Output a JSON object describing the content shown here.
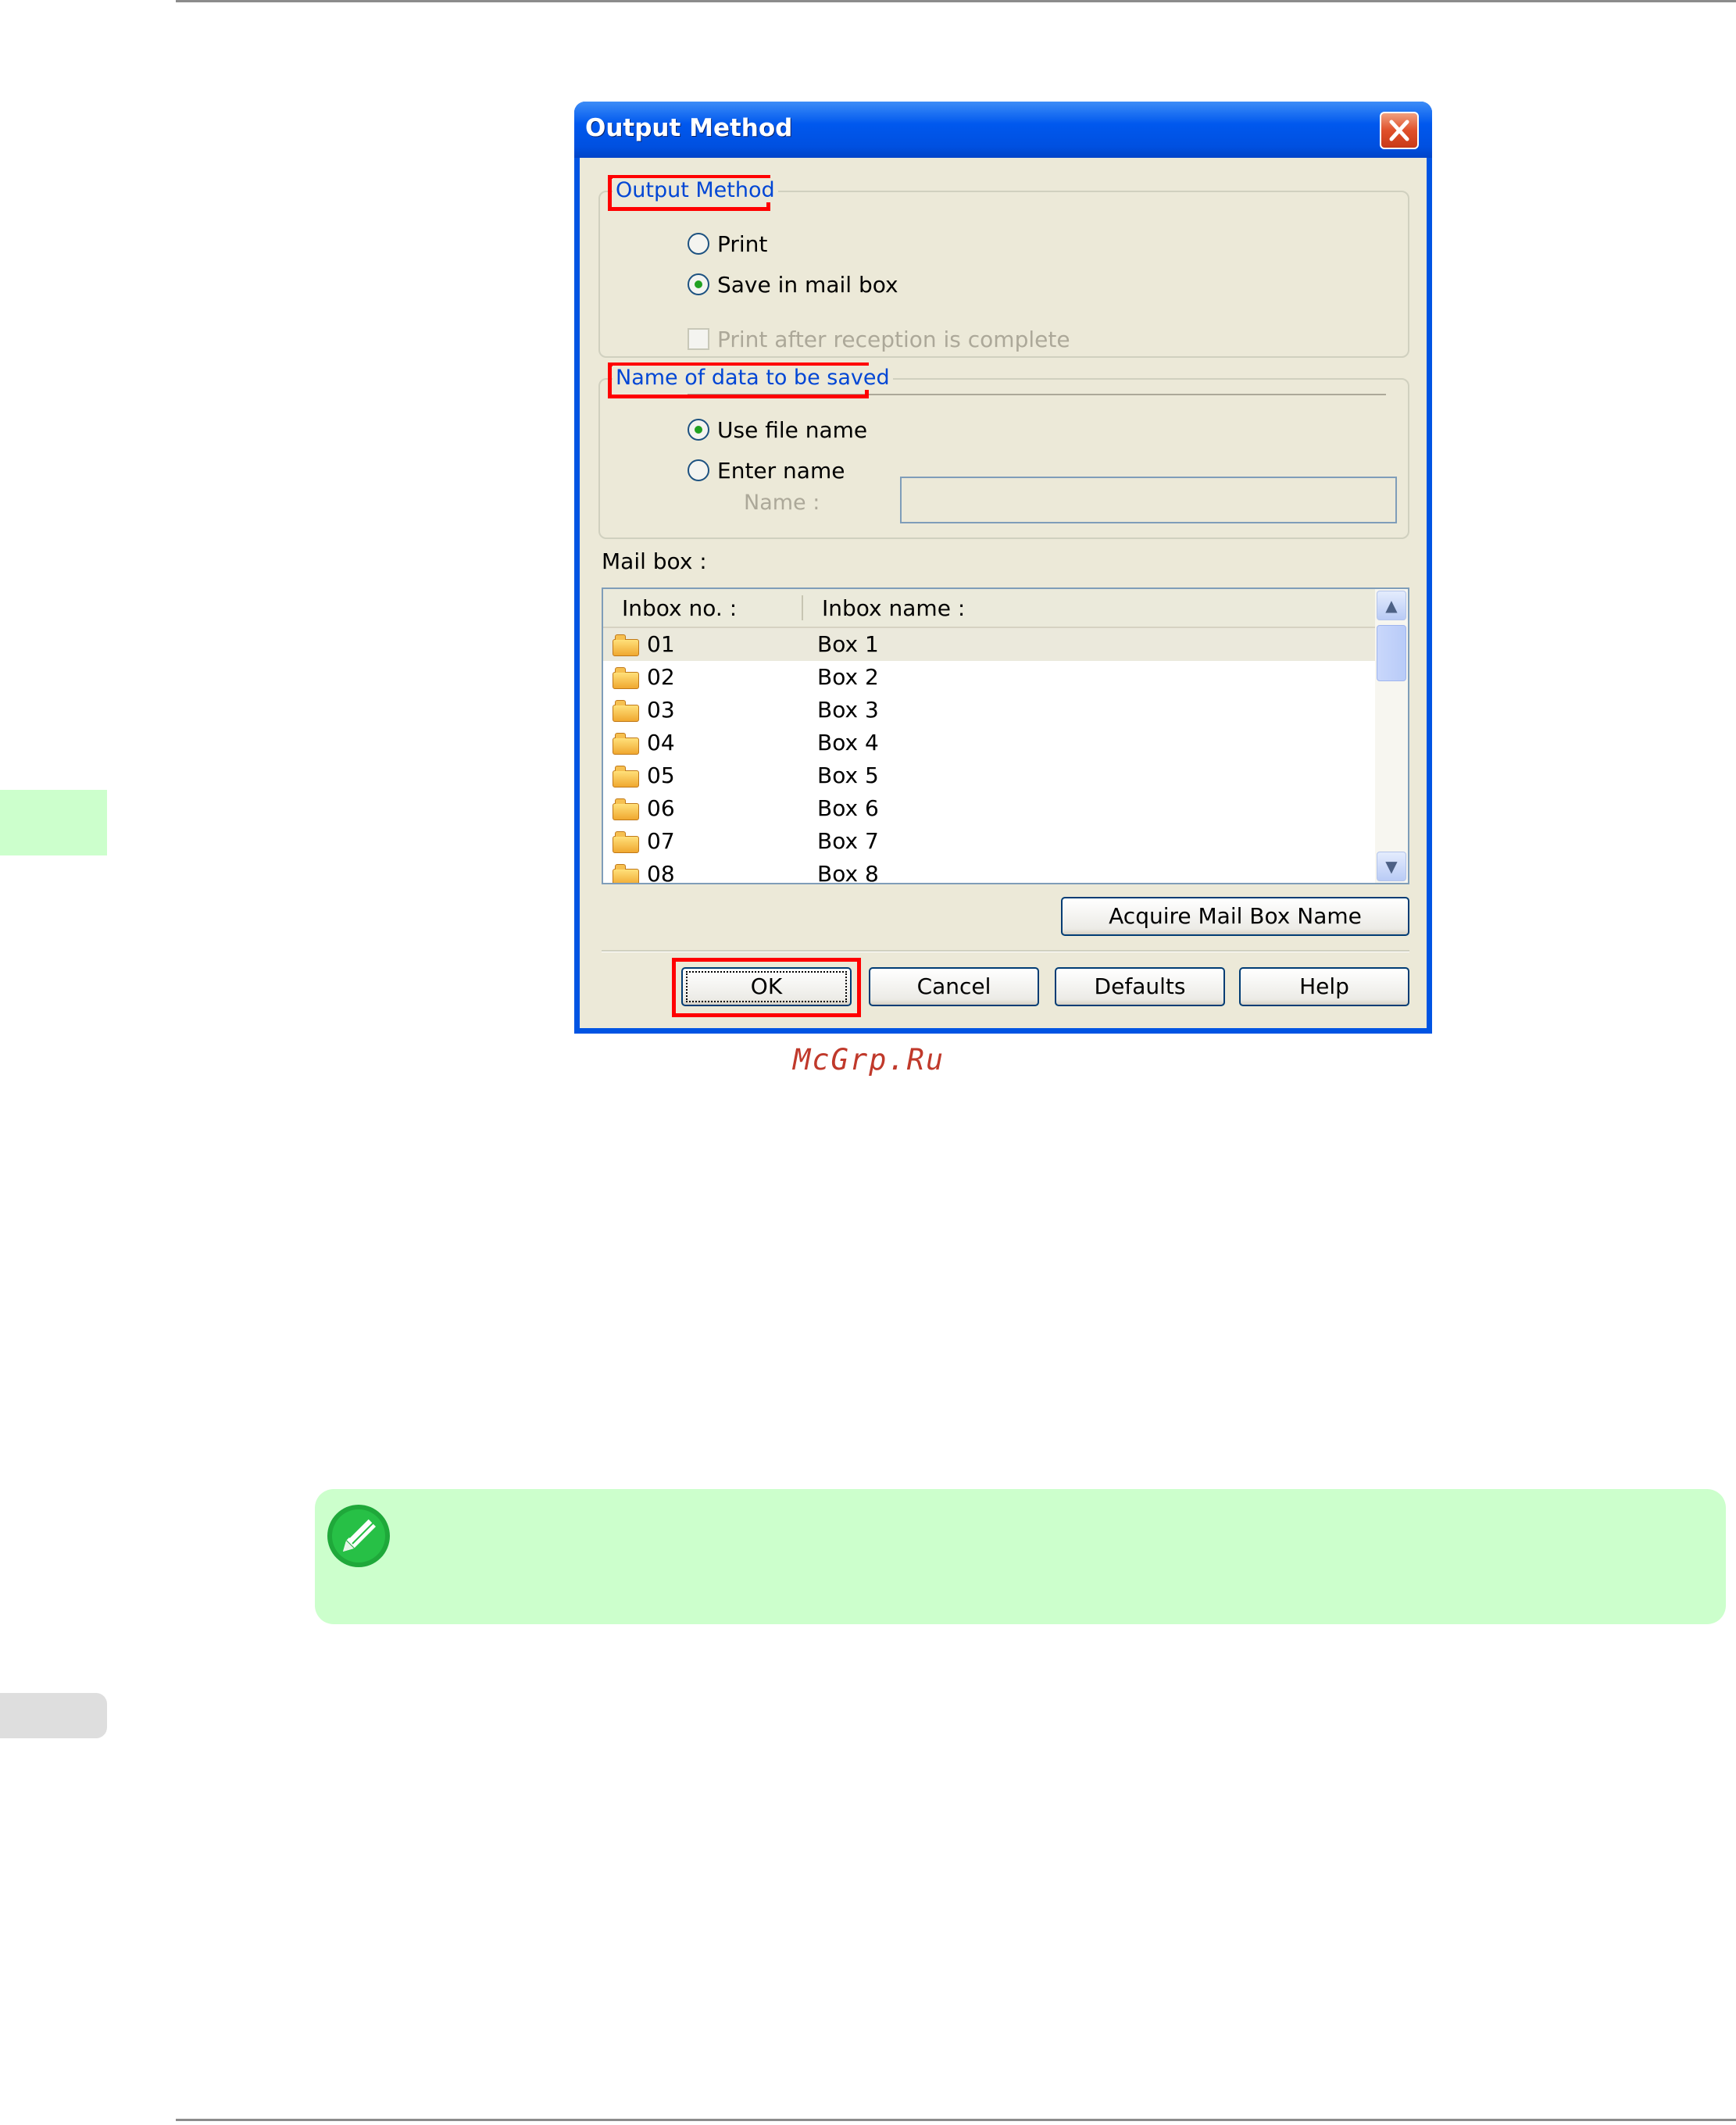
{
  "watermark": "McGrp.Ru",
  "dialog": {
    "title": "Output Method",
    "output_method": {
      "legend": "Output Method",
      "options": [
        "Print",
        "Save in mail box"
      ],
      "selected": 1,
      "checkbox_label": "Print after reception is complete",
      "checkbox_enabled": false
    },
    "name_of_data": {
      "legend": "Name of data to be saved",
      "options": [
        "Use file name",
        "Enter name"
      ],
      "selected": 0,
      "name_label": "Name :",
      "name_value": ""
    },
    "mailbox_label": "Mail box :",
    "list": {
      "headers": [
        "Inbox no. :",
        "Inbox name :"
      ],
      "rows": [
        {
          "no": "01",
          "name": "Box 1"
        },
        {
          "no": "02",
          "name": "Box 2"
        },
        {
          "no": "03",
          "name": "Box 3"
        },
        {
          "no": "04",
          "name": "Box 4"
        },
        {
          "no": "05",
          "name": "Box 5"
        },
        {
          "no": "06",
          "name": "Box 6"
        },
        {
          "no": "07",
          "name": "Box 7"
        },
        {
          "no": "08",
          "name": "Box 8"
        }
      ],
      "selected_row": 0
    },
    "buttons": {
      "acquire": "Acquire Mail Box Name",
      "ok": "OK",
      "cancel": "Cancel",
      "defaults": "Defaults",
      "help": "Help"
    }
  },
  "colors": {
    "highlight_box": "#ff0000",
    "note_background": "#ccffcc",
    "side_tab": "#ccffcc",
    "legend_text": "#0046d5"
  },
  "icons": {
    "note": "pencil-note-icon",
    "close": "close-icon",
    "inbox": "folder-icon"
  }
}
